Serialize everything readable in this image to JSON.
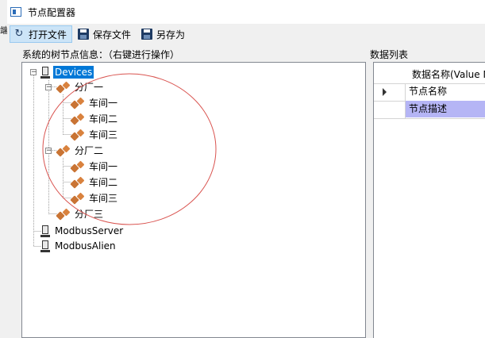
{
  "side_window": {
    "glyph": "端"
  },
  "window": {
    "title": "节点配置器"
  },
  "toolbar": {
    "open_label": "打开文件",
    "save_label": "保存文件",
    "saveas_label": "另存为"
  },
  "tree_panel": {
    "label": "系统的树节点信息：（右键进行操作）",
    "nodes": {
      "devices": "Devices",
      "factory1": "分厂一",
      "f1_ws1": "车间一",
      "f1_ws2": "车间二",
      "f1_ws3": "车间三",
      "factory2": "分厂二",
      "f2_ws1": "车间一",
      "f2_ws2": "车间二",
      "f2_ws3": "车间三",
      "factory3": "分厂三",
      "modbus_server": "ModbusServer",
      "modbus_alien": "ModbusAlien"
    }
  },
  "grid_panel": {
    "label": "数据列表",
    "column_header": "数据名称(Value Na",
    "rows": [
      "节点名称",
      "节点描述"
    ]
  },
  "colors": {
    "selection": "#0078d7",
    "grid_selection": "#b5b5f5",
    "annotation_circle": "#d9534f",
    "node_icon": "#c97434"
  }
}
